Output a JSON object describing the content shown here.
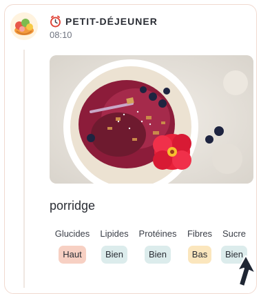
{
  "meal": {
    "title": "PETIT-DÉJEUNER",
    "time": "08:10",
    "food_name": "porridge"
  },
  "nutrients": [
    {
      "label": "Glucides",
      "level": "Haut"
    },
    {
      "label": "Lipides",
      "level": "Bien"
    },
    {
      "label": "Protéines",
      "level": "Bien"
    },
    {
      "label": "Fibres",
      "level": "Bas"
    },
    {
      "label": "Sucre",
      "level": "Bien"
    }
  ],
  "colors": {
    "haut": "#f7d0c3",
    "bien": "#dcecec",
    "bas": "#fbe6bd",
    "card_border": "#f1d9cf"
  },
  "icons": {
    "meal_avatar": "fruit-plate-icon",
    "title_icon": "alarm-clock-icon",
    "cursor": "mouse-cursor-icon"
  }
}
